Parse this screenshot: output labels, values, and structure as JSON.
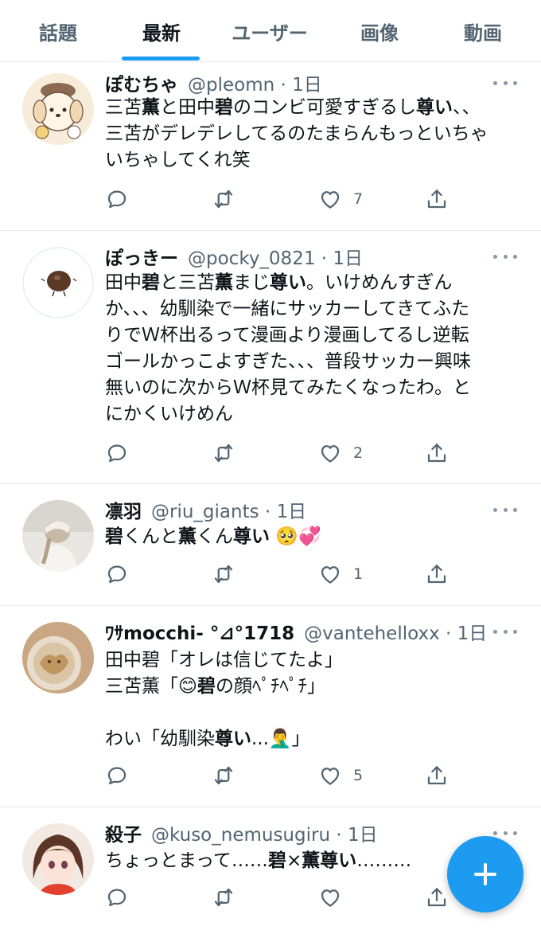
{
  "tabs": [
    {
      "label": "話題"
    },
    {
      "label": "最新"
    },
    {
      "label": "ユーザー"
    },
    {
      "label": "画像"
    },
    {
      "label": "動画"
    }
  ],
  "active_tab": "最新",
  "colors": {
    "accent": "#1d9bf0",
    "text": "#0f1419",
    "muted": "#536471"
  },
  "tweets": [
    {
      "name": "ぽむちゃ",
      "handle": "@pleomn · 1日",
      "avatar": "character-avatar",
      "lines": [
        [
          {
            "t": "三苫"
          },
          {
            "t": "薫",
            "b": true
          },
          {
            "t": "と田中"
          },
          {
            "t": "碧",
            "b": true
          },
          {
            "t": "のコンビ可愛すぎるし"
          },
          {
            "t": "尊い",
            "b": true
          },
          {
            "t": "、、"
          }
        ],
        [
          {
            "t": "三苫がデレデレしてるのたまらんもっといちゃ"
          }
        ],
        [
          {
            "t": "いちゃしてくれ笑"
          }
        ]
      ],
      "likes": "7"
    },
    {
      "name": "ぽっきー",
      "handle": "@pocky_0821 · 1日",
      "avatar": "chestnut-avatar",
      "lines": [
        [
          {
            "t": "田中"
          },
          {
            "t": "碧",
            "b": true
          },
          {
            "t": "と三苫"
          },
          {
            "t": "薫",
            "b": true
          },
          {
            "t": "まじ"
          },
          {
            "t": "尊い",
            "b": true
          },
          {
            "t": "。いけめんすぎん"
          }
        ],
        [
          {
            "t": "か、、、幼馴染で一緒にサッカーしてきてふた"
          }
        ],
        [
          {
            "t": "りでＷ杯出るって漫画より漫画してるし逆転"
          }
        ],
        [
          {
            "t": "ゴールかっこよすぎた、、、普段サッカー興味"
          }
        ],
        [
          {
            "t": "無いのに次からＷ杯見てみたくなったわ。と"
          }
        ],
        [
          {
            "t": "にかくいけめん"
          }
        ]
      ],
      "likes": "2"
    },
    {
      "name": "凛羽",
      "handle": "@riu_giants · 1日",
      "avatar": "photo-avatar",
      "lines": [
        [
          {
            "t": "碧",
            "b": true
          },
          {
            "t": "くんと"
          },
          {
            "t": "薫",
            "b": true
          },
          {
            "t": "くん"
          },
          {
            "t": "尊い",
            "b": true
          },
          {
            "t": " 🥺💞"
          }
        ]
      ],
      "likes": "1"
    },
    {
      "name": "ﾜｻmocchi- °⊿°1718",
      "handle": "@vantehelloxx · 1日",
      "avatar": "latte-art-avatar",
      "lines": [
        [
          {
            "t": "田中碧「オレは信じてたよ」"
          }
        ],
        [
          {
            "t": "三苫薫「😊"
          },
          {
            "t": "碧",
            "b": true
          },
          {
            "t": "の顔ﾍﾟﾁﾍﾟﾁ」"
          }
        ],
        [
          {
            "t": ""
          }
        ],
        [
          {
            "t": "わい「幼馴染"
          },
          {
            "t": "尊い",
            "b": true
          },
          {
            "t": "...🤦‍♂️」"
          }
        ]
      ],
      "likes": "5"
    },
    {
      "name": "殺子",
      "handle": "@kuso_nemusugiru · 1日",
      "avatar": "anime-girl-avatar",
      "lines": [
        [
          {
            "t": "ちょっとまって……"
          },
          {
            "t": "碧",
            "b": true
          },
          {
            "t": "×"
          },
          {
            "t": "薫尊い",
            "b": true
          },
          {
            "t": "………"
          }
        ]
      ],
      "likes": ""
    }
  ]
}
